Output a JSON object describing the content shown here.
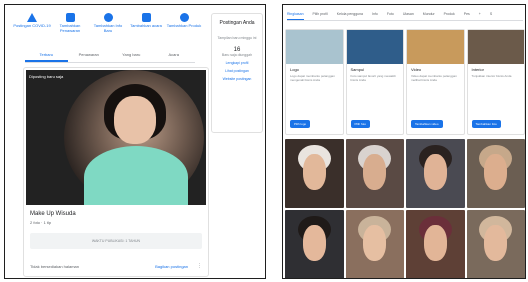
{
  "left": {
    "actions": [
      {
        "label": "Postingan COVID-19",
        "icon": "alert-icon"
      },
      {
        "label": "Tambahkan Penawaran",
        "icon": "tag-icon"
      },
      {
        "label": "Tambahkan Info Baru",
        "icon": "info-icon"
      },
      {
        "label": "Tambahkan acara",
        "icon": "calendar-icon"
      },
      {
        "label": "Tambahkan Produk",
        "icon": "bag-icon"
      }
    ],
    "tabs": [
      "Terbaru",
      "Penawaran",
      "Yang baru",
      "Acara"
    ],
    "post": {
      "badge": "Diposting baru saja",
      "title": "Make Up Wisuda",
      "subtitle": "2 foto · 1 tlp",
      "box_text": "WAKTU PUBLIKASI: 1 TAHUN",
      "footer": "Tidak bersediakan halaman",
      "share": "Bagikan postingan",
      "more": "⋮"
    },
    "side": {
      "title": "Postingan Anda",
      "desc": "Tampilan baru minggu ini",
      "count": "16",
      "count_label": "Baru saja diunggah",
      "links": [
        "Lengkapi profil",
        "Lihat postingan",
        "Website postingan"
      ]
    }
  },
  "right": {
    "tabs": [
      "Ringkasan",
      "Pilih profil",
      "Kelola pengguna",
      "Info",
      "Foto",
      "Ulasan",
      "Mundur",
      "Produk",
      "Pes",
      "+",
      "S"
    ],
    "categories": [
      {
        "title": "Logo",
        "desc": "Logo dapat membantu pelanggan mengenali bisnis Anda",
        "button": "Pilih logo"
      },
      {
        "title": "Sampul",
        "desc": "Foto sampul favorit yang mewakili bisnis Anda",
        "button": "Pilih foto"
      },
      {
        "title": "Video",
        "desc": "Video dapat membantu pelanggan melihat bisnis Anda",
        "button": "Tambahkan video"
      },
      {
        "title": "Interior",
        "desc": "Tunjukkan interior bisnis Anda",
        "button": "Tambahkan foto"
      }
    ]
  },
  "colors": {
    "accent": "#1a73e8"
  }
}
